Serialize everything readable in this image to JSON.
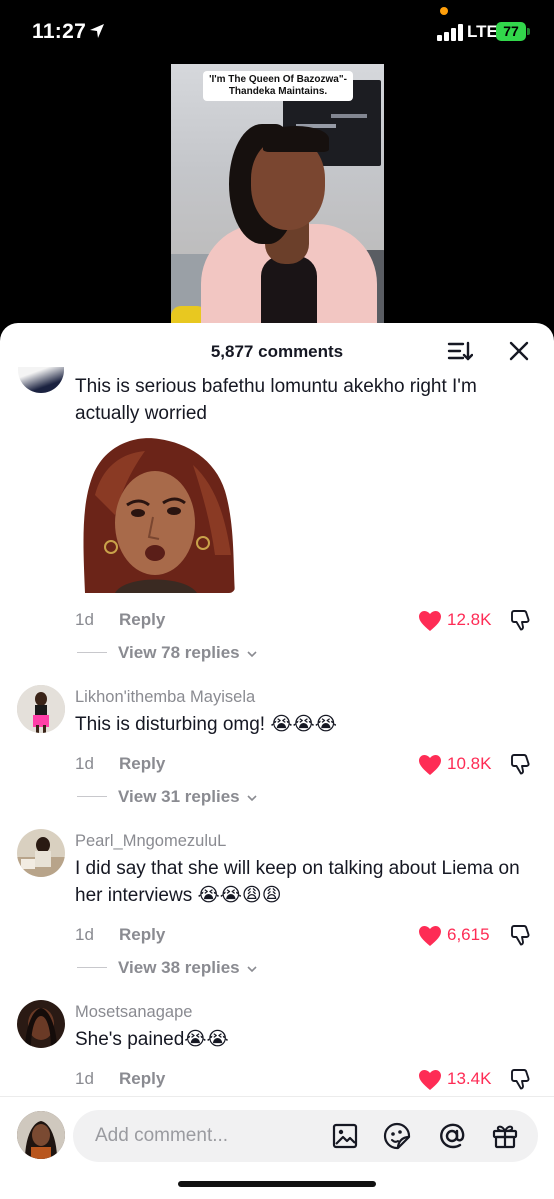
{
  "status_bar": {
    "time": "11:27",
    "network": "LTE",
    "battery": "77"
  },
  "video": {
    "caption": "'I'm The Queen Of Bazozwa\"- Thandeka Maintains."
  },
  "sheet": {
    "comments_count": "5,877 comments"
  },
  "comments": [
    {
      "username": "",
      "text": "This is serious bafethu lomuntu akekho right I'm actually worried",
      "has_gif": true,
      "age": "1d",
      "reply_label": "Reply",
      "likes": "12.8K",
      "view_replies": "View 78 replies"
    },
    {
      "username": "Likhon'ithemba Mayisela",
      "text": "This is disturbing omg! 😭😭😭",
      "age": "1d",
      "reply_label": "Reply",
      "likes": "10.8K",
      "view_replies": "View 31 replies"
    },
    {
      "username": "Pearl_MngomezuluL",
      "text": "I did say that she will keep on talking about Liema on her interviews 😭😭😩😩",
      "age": "1d",
      "reply_label": "Reply",
      "likes": "6,615",
      "view_replies": "View 38 replies"
    },
    {
      "username": "Mosetsanagape",
      "text": "She's pained😭😭",
      "age": "1d",
      "reply_label": "Reply",
      "likes": "13.4K"
    }
  ],
  "composer": {
    "placeholder": "Add comment..."
  },
  "colors": {
    "like_red": "#fe2c55",
    "muted_text": "#8a8b91",
    "primary_text": "#161823"
  },
  "icons": [
    "location-arrow-icon",
    "signal-icon",
    "battery-icon",
    "sort-icon",
    "close-icon",
    "heart-icon",
    "dislike-icon",
    "chevron-down-icon",
    "image-icon",
    "sticker-icon",
    "at-icon",
    "gift-icon"
  ]
}
